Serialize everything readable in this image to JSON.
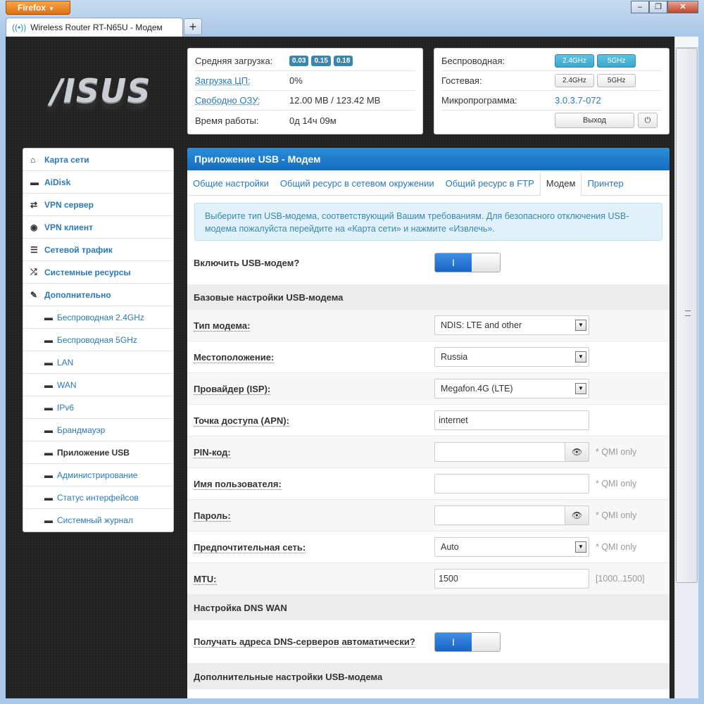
{
  "browser": {
    "app_button": "Firefox",
    "tab_title": "Wireless Router RT-N65U - Модем",
    "new_tab": "+",
    "controls": [
      "–",
      "❐",
      "✕"
    ]
  },
  "logo": "/ISUS",
  "status": {
    "load_label": "Средняя загрузка:",
    "load_values": [
      "0.03",
      "0.15",
      "0.18"
    ],
    "cpu_label": "Загрузка ЦП:",
    "cpu_value": "0%",
    "ram_label": "Свободно ОЗУ:",
    "ram_value": "12.00 MB / 123.42 MB",
    "uptime_label": "Время работы:",
    "uptime_value": "0д 14ч 09м"
  },
  "wireless": {
    "wireless_label": "Беспроводная:",
    "guest_label": "Гостевая:",
    "band_24": "2.4GHz",
    "band_5": "5GHz",
    "firmware_label": "Микропрограмма:",
    "firmware_value": "3.0.3.7-072",
    "logout": "Выход",
    "power_icon": "⏻"
  },
  "sidebar": {
    "items": [
      {
        "icon": "⌂",
        "label": "Карта сети"
      },
      {
        "icon": "▬",
        "label": "AiDisk"
      },
      {
        "icon": "⇄",
        "label": "VPN сервер"
      },
      {
        "icon": "◉",
        "label": "VPN клиент"
      },
      {
        "icon": "☰",
        "label": "Сетевой трафик"
      },
      {
        "icon": "⤮",
        "label": "Системные ресурсы"
      },
      {
        "icon": "✎",
        "label": "Дополнительно"
      }
    ],
    "subitems": [
      "Беспроводная 2.4GHz",
      "Беспроводная 5GHz",
      "LAN",
      "WAN",
      "IPv6",
      "Брандмауэр",
      "Приложение USB",
      "Администрирование",
      "Статус интерфейсов",
      "Системный журнал"
    ],
    "dash": "▬"
  },
  "main": {
    "title": "Приложение USB - Модем",
    "tabs": [
      "Общие настройки",
      "Общий ресурс в сетевом окружении",
      "Общий ресурс в FTP",
      "Модем",
      "Принтер"
    ],
    "alert": "Выберите тип USB-модема, соответствующий Вашим требованиям. Для безопасного отключения USB-модема пожалуйста перейдите на «Карта сети» и нажмите «Извлечь».",
    "enable_label": "Включить USB-модем?",
    "toggle_on": "I",
    "section_basic": "Базовые настройки USB-модема",
    "modem_type_label": "Тип модема:",
    "modem_type_value": "NDIS: LTE and other",
    "location_label": "Местоположение:",
    "location_value": "Russia",
    "isp_label": "Провайдер (ISP):",
    "isp_value": "Megafon.4G (LTE)",
    "apn_label": "Точка доступа (APN):",
    "apn_value": "internet",
    "pin_label": "PIN-код:",
    "pin_value": "",
    "user_label": "Имя пользователя:",
    "user_value": "",
    "pass_label": "Пароль:",
    "pass_value": "",
    "net_label": "Предпочтительная сеть:",
    "net_value": "Auto",
    "mtu_label": "MTU:",
    "mtu_value": "1500",
    "mtu_range": "[1000..1500]",
    "qmi_note": "* QMI only",
    "section_dns": "Настройка DNS WAN",
    "dns_label": "Получать адреса DNS-серверов автоматически?",
    "section_adv": "Дополнительные настройки USB-модема",
    "dropdown_arrow": "▼",
    "eye_icon": "👁"
  }
}
